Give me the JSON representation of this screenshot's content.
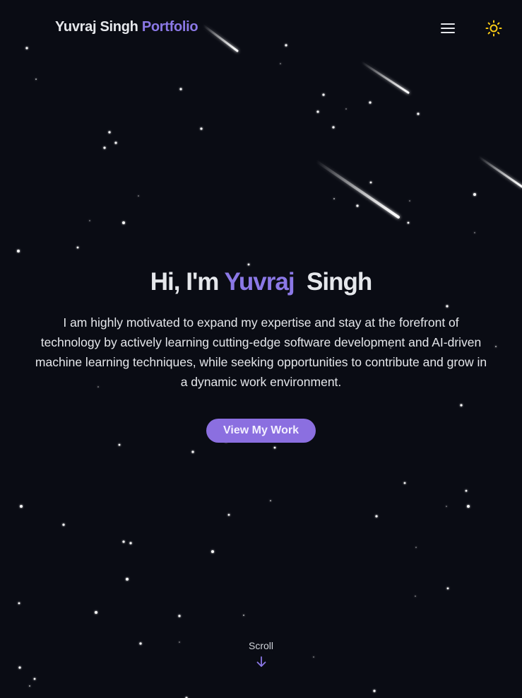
{
  "header": {
    "brand_name": "Yuvraj Singh",
    "brand_accent": "Portfolio",
    "menu_icon": "hamburger-menu-icon",
    "theme_icon": "sun-icon"
  },
  "hero": {
    "greeting": "Hi, I'm",
    "first_name": "Yuvraj",
    "last_name": "Singh",
    "intro": "I am highly motivated to expand my expertise and stay at the forefront of technology by actively learning cutting-edge software development and AI-driven machine learning techniques, while seeking opportunities to contribute and grow in a dynamic work environment.",
    "cta_label": "View My Work"
  },
  "scroll": {
    "label": "Scroll",
    "icon": "arrow-down-icon"
  },
  "colors": {
    "background": "#0a0c14",
    "accent": "#8b78e6",
    "button": "#8b6fe0",
    "text": "#e5e7eb",
    "sun": "#facc15"
  }
}
